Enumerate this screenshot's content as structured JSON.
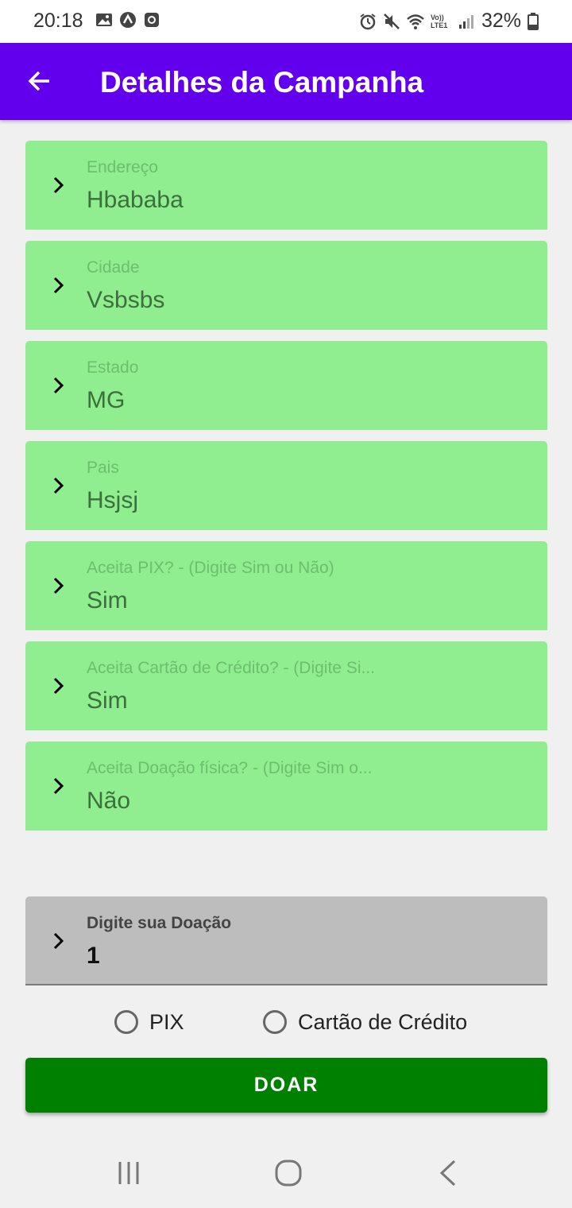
{
  "status_bar": {
    "time": "20:18",
    "battery": "32%",
    "left_icons": [
      "image-icon",
      "arrow-app-icon",
      "square-app-icon"
    ],
    "right_icons": [
      "alarm-icon",
      "mute-icon",
      "wifi-icon",
      "volte-icon",
      "signal-icon",
      "battery-icon"
    ],
    "volte_text": "Vo)) LTE1"
  },
  "app_bar": {
    "title": "Detalhes da Campanha",
    "back_icon": "back-arrow-icon"
  },
  "fields": [
    {
      "label": "Endereço",
      "value": "Hbababa"
    },
    {
      "label": "Cidade",
      "value": "Vsbsbs"
    },
    {
      "label": "Estado",
      "value": "MG"
    },
    {
      "label": "Pais",
      "value": "Hsjsj"
    },
    {
      "label": "Aceita PIX? - (Digite Sim ou Não)",
      "value": "Sim"
    },
    {
      "label": "Aceita Cartão de Crédito? - (Digite Si...",
      "value": "Sim"
    },
    {
      "label": "Aceita Doação física? - (Digite Sim o...",
      "value": "Não"
    }
  ],
  "donation": {
    "label": "Digite sua Doação",
    "value": "1"
  },
  "payment_options": [
    {
      "label": "PIX",
      "selected": false
    },
    {
      "label": "Cartão de Crédito",
      "selected": false
    }
  ],
  "submit_button": {
    "label": "DOAR"
  },
  "colors": {
    "app_bar": "#6200ee",
    "field_background": "#90ee90",
    "donation_background": "#bdbdbd",
    "button": "#008000"
  },
  "nav_bar": {
    "buttons": [
      "recents-icon",
      "home-icon",
      "back-icon"
    ]
  }
}
